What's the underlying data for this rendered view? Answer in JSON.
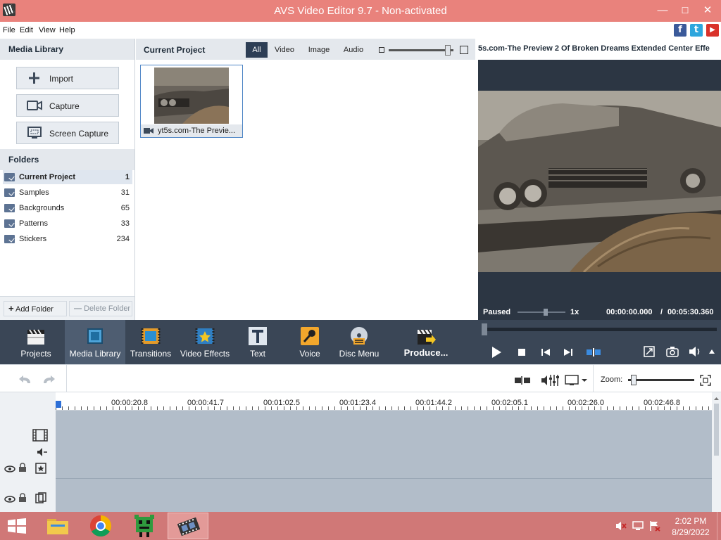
{
  "window": {
    "title": "AVS Video Editor 9.7 - Non-activated",
    "minimize": "—",
    "restore": "☐",
    "close": "✕"
  },
  "menu": {
    "items": [
      "File",
      "Edit",
      "View",
      "Help"
    ]
  },
  "social": {
    "facebook": "f",
    "twitter": "t",
    "youtube": "▶"
  },
  "media_library": {
    "title": "Media Library",
    "buttons": {
      "import": "Import",
      "capture": "Capture",
      "screen_capture": "Screen Capture"
    },
    "folders_title": "Folders",
    "folders": [
      {
        "name": "Current Project",
        "count": "1"
      },
      {
        "name": "Samples",
        "count": "31"
      },
      {
        "name": "Backgrounds",
        "count": "65"
      },
      {
        "name": "Patterns",
        "count": "33"
      },
      {
        "name": "Stickers",
        "count": "234"
      }
    ],
    "add_folder": "Add Folder",
    "delete_folder": "Delete Folder"
  },
  "project": {
    "title": "Current Project",
    "filters": [
      "All",
      "Video",
      "Image",
      "Audio"
    ],
    "active_filter": "All",
    "thumbnail_size": 0.95,
    "media": [
      {
        "name": "yt5s.com-The Previe..."
      }
    ]
  },
  "preview": {
    "title": "5s.com-The Preview 2 Of Broken Dreams Extended Center Effe",
    "status": "Paused",
    "speed": "1x",
    "time_current": "00:00:00.000",
    "time_separator": "/",
    "time_total": "00:05:30.360",
    "speed_slider": 0.6,
    "volume": 1
  },
  "toolbar": {
    "items": [
      {
        "label": "Projects",
        "icon": "clapper-icon"
      },
      {
        "label": "Media Library",
        "icon": "media-library-icon"
      },
      {
        "label": "Transitions",
        "icon": "transitions-icon"
      },
      {
        "label": "Video Effects",
        "icon": "video-effects-icon"
      },
      {
        "label": "Text",
        "icon": "text-icon"
      },
      {
        "label": "Voice",
        "icon": "microphone-icon"
      },
      {
        "label": "Disc Menu",
        "icon": "disc-menu-icon"
      }
    ],
    "produce": "Produce...",
    "active": "Media Library"
  },
  "timeline": {
    "zoom_label": "Zoom:",
    "zoom_level": 0.05,
    "ruler": [
      "00:00:20.8",
      "00:00:41.7",
      "00:01:02.5",
      "00:01:23.4",
      "00:01:44.2",
      "00:02:05.1",
      "00:02:26.0",
      "00:02:46.8"
    ]
  },
  "taskbar": {
    "time": "2:02 PM",
    "date": "8/29/2022"
  },
  "colors": {
    "titlebar": "#e9827c",
    "toolbar": "#3a4656",
    "accent": "#2d3e55",
    "taskbar": "#d07877"
  }
}
